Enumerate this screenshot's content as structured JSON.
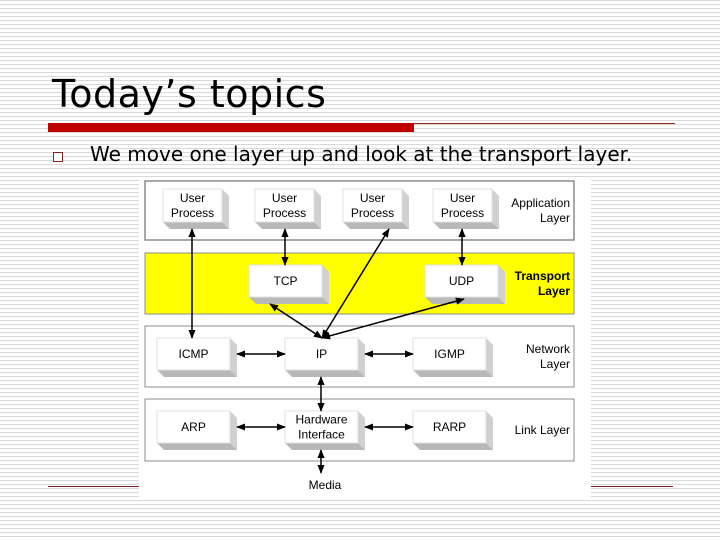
{
  "slide": {
    "title": "Today’s topics",
    "bullets": [
      {
        "icon": "hollow-square-bullet-icon",
        "text": "We move one layer up and look at the transport layer."
      }
    ]
  },
  "diagram": {
    "layers": [
      {
        "name": "Application Layer",
        "label_lines": [
          "Application",
          "Layer"
        ],
        "highlight": false,
        "boxes": [
          "User Process",
          "User Process",
          "User Process",
          "User Process"
        ]
      },
      {
        "name": "Transport Layer",
        "label_lines": [
          "Transport",
          "Layer"
        ],
        "highlight": true,
        "boxes": [
          "TCP",
          "UDP"
        ]
      },
      {
        "name": "Network Layer",
        "label_lines": [
          "Network",
          "Layer"
        ],
        "highlight": false,
        "boxes": [
          "ICMP",
          "IP",
          "IGMP"
        ]
      },
      {
        "name": "Link Layer",
        "label_lines": [
          "Link Layer"
        ],
        "highlight": false,
        "boxes": [
          "ARP",
          "Hardware Interface",
          "RARP"
        ]
      }
    ],
    "box_labels": {
      "up1": [
        "User",
        "Process"
      ],
      "up2": [
        "User",
        "Process"
      ],
      "up3": [
        "User",
        "Process"
      ],
      "up4": [
        "User",
        "Process"
      ],
      "tcp": [
        "TCP"
      ],
      "udp": [
        "UDP"
      ],
      "icmp": [
        "ICMP"
      ],
      "ip": [
        "IP"
      ],
      "igmp": [
        "IGMP"
      ],
      "arp": [
        "ARP"
      ],
      "hw": [
        "Hardware",
        "Interface"
      ],
      "rarp": [
        "RARP"
      ]
    },
    "media_label": "Media",
    "connections": [
      [
        "up1",
        "icmp"
      ],
      [
        "up2",
        "tcp"
      ],
      [
        "up3",
        "ip"
      ],
      [
        "up4",
        "udp"
      ],
      [
        "tcp",
        "ip"
      ],
      [
        "udp",
        "ip"
      ],
      [
        "icmp",
        "ip"
      ],
      [
        "ip",
        "igmp"
      ],
      [
        "ip",
        "hw"
      ],
      [
        "arp",
        "hw"
      ],
      [
        "hw",
        "rarp"
      ],
      [
        "hw",
        "media"
      ]
    ],
    "colors": {
      "transport_highlight": "#ffff00",
      "box_face": "#ffffff",
      "box_shadow": "#b8b8b8",
      "accent_red": "#c00000"
    }
  }
}
